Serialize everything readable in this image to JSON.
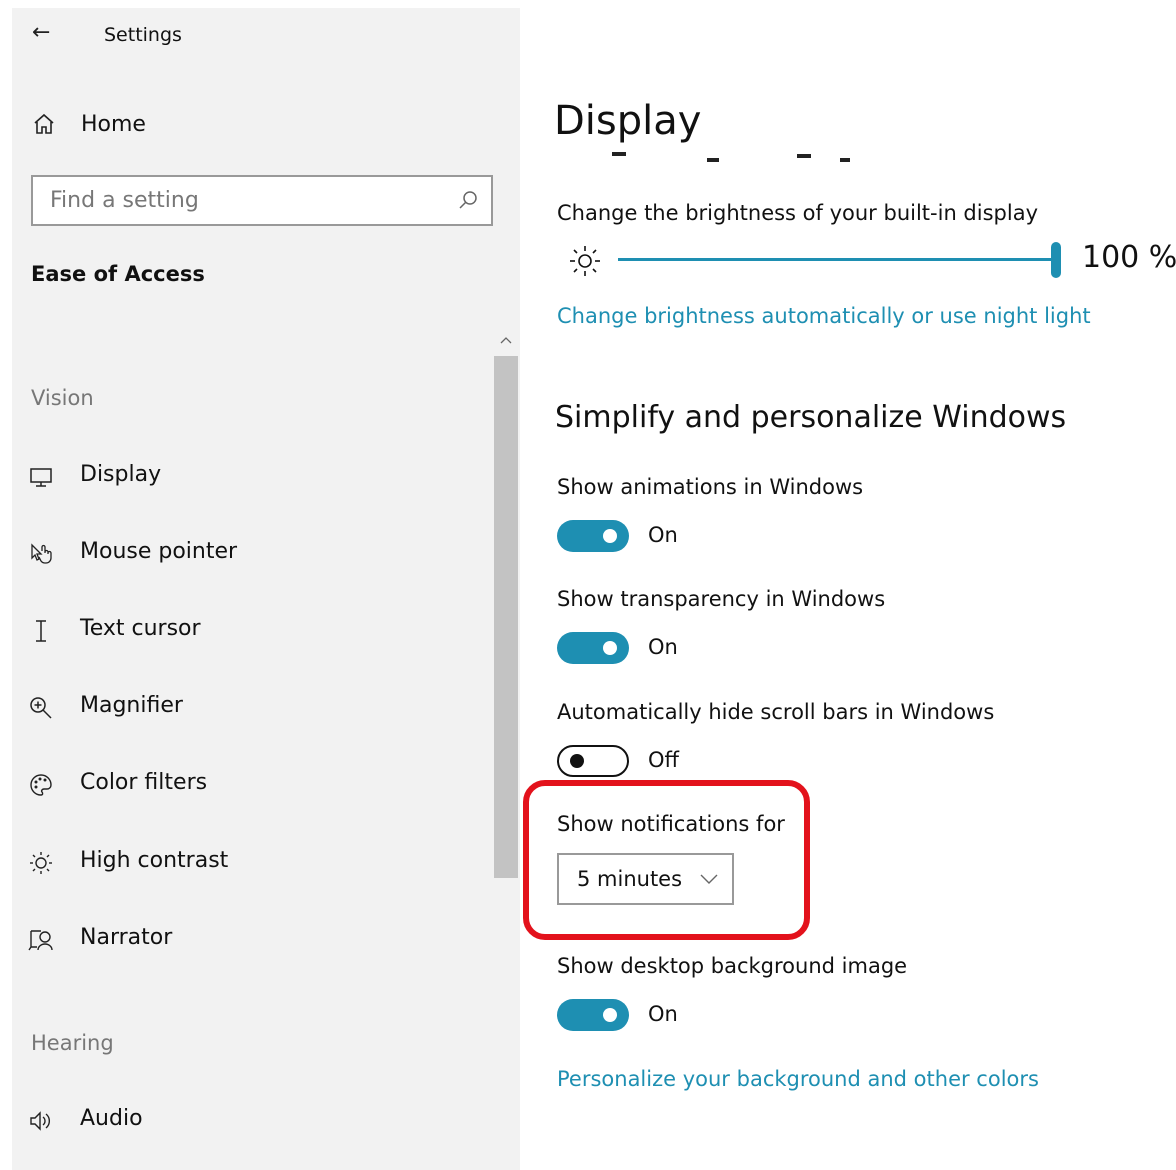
{
  "app": {
    "title": "Settings"
  },
  "sidebar": {
    "home_label": "Home",
    "search": {
      "placeholder": "Find a setting"
    },
    "section_title": "Ease of Access",
    "groups": [
      {
        "label": "Vision",
        "items": [
          {
            "label": "Display",
            "icon": "monitor-icon"
          },
          {
            "label": "Mouse pointer",
            "icon": "pointer-icon"
          },
          {
            "label": "Text cursor",
            "icon": "text-cursor-icon"
          },
          {
            "label": "Magnifier",
            "icon": "magnifier-icon"
          },
          {
            "label": "Color filters",
            "icon": "palette-icon"
          },
          {
            "label": "High contrast",
            "icon": "contrast-sun-icon"
          },
          {
            "label": "Narrator",
            "icon": "narrator-icon"
          }
        ]
      },
      {
        "label": "Hearing",
        "items": [
          {
            "label": "Audio",
            "icon": "speaker-icon"
          }
        ]
      }
    ]
  },
  "main": {
    "page_title": "Display",
    "brightness": {
      "label": "Change the brightness of your built-in display",
      "value": 100,
      "value_text": "100 %",
      "link": "Change brightness automatically or use night light"
    },
    "simplify": {
      "heading": "Simplify and personalize Windows",
      "settings": [
        {
          "label": "Show animations in Windows",
          "state": "On",
          "on": true
        },
        {
          "label": "Show transparency in Windows",
          "state": "On",
          "on": true
        },
        {
          "label": "Automatically hide scroll bars in Windows",
          "state": "Off",
          "on": false
        }
      ],
      "notifications": {
        "label": "Show notifications for",
        "value": "5 minutes"
      },
      "desktop_background": {
        "label": "Show desktop background image",
        "state": "On",
        "on": true
      },
      "personalize_link": "Personalize your background and other colors"
    }
  },
  "colors": {
    "accent": "#1e8fb2",
    "highlight": "#e3121c"
  }
}
